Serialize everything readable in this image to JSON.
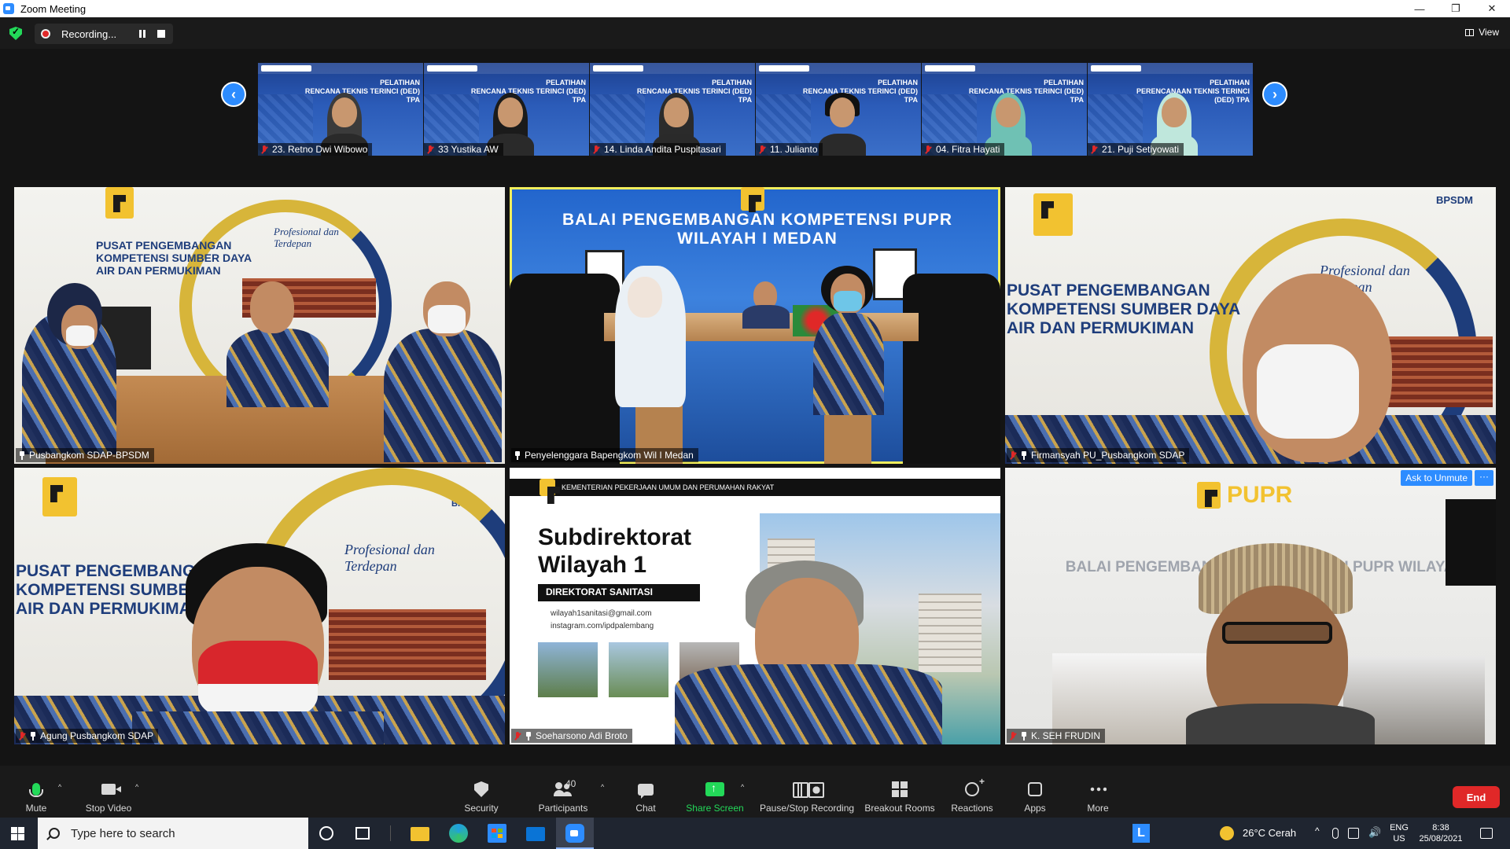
{
  "window": {
    "title": "Zoom Meeting",
    "minimize": "—",
    "restore": "❐",
    "close": "✕"
  },
  "topbar": {
    "recording_label": "Recording...",
    "view_label": "View"
  },
  "thumbnails": [
    {
      "name": "23. Retno Dwi Wibowo",
      "banner": "RENCANA TEKNIS TERINCI (DED) TPA",
      "kicker": "PELATIHAN",
      "hijab": "#3b3b3b"
    },
    {
      "name": "33 Yustika AW",
      "banner": "RENCANA TEKNIS TERINCI (DED) TPA",
      "kicker": "PELATIHAN",
      "hijab": "#1b1b1b"
    },
    {
      "name": "14. Linda Andita Puspitasari",
      "banner": "RENCANA TEKNIS TERINCI (DED) TPA",
      "kicker": "PELATIHAN",
      "hijab": "#2b2b2b"
    },
    {
      "name": "11. Julianto",
      "banner": "RENCANA TEKNIS TERINCI (DED) TPA",
      "kicker": "PELATIHAN",
      "hijab": "#111111"
    },
    {
      "name": "04. Fitra Hayati",
      "banner": "RENCANA TEKNIS TERINCI (DED) TPA",
      "kicker": "PELATIHAN",
      "hijab": "#6fc1b4"
    },
    {
      "name": "21. Puji Setiyowati",
      "banner": "PERENCANAAN TEKNIS TERINCI (DED) TPA",
      "kicker": "PELATIHAN",
      "hijab": "#bfe7dc"
    }
  ],
  "tiles": [
    {
      "name": "Pusbangkom SDAP-BPSDM",
      "banner": "PUSAT PENGEMBANGAN KOMPETENSI SUMBER DAYA AIR DAN PERMUKIMAN",
      "slogan": "Profesional dan Terdepan"
    },
    {
      "name": "Penyelenggara Bapengkom Wil I Medan",
      "banner": "BALAI PENGEMBANGAN KOMPETENSI PUPR WILAYAH I MEDAN"
    },
    {
      "name": "Firmansyah PU_Pusbangkom SDAP",
      "banner": "PUSAT PENGEMBANGAN KOMPETENSI SUMBER DAYA AIR DAN PERMUKIMAN",
      "slogan": "Profesional dan Terdepan",
      "brand": "BPSDM"
    },
    {
      "name": "Agung Pusbangkom SDAP",
      "banner": "PUSAT PENGEMBANGAN KOMPETENSI SUMBER DAYA AIR DAN PERMUKIMAN",
      "slogan": "Profesional dan Terdepan",
      "brand": "BPSDM"
    },
    {
      "name": "Soeharsono Adi Broto",
      "ministry": "KEMENTERIAN PEKERJAAN UMUM DAN PERUMAHAN RAKYAT",
      "title": "Subdirektorat Wilayah 1",
      "subtitle": "DIREKTORAT SANITASI",
      "email": "wilayah1sanitasi@gmail.com",
      "instagram": "instagram.com/ipdpalembang"
    },
    {
      "name": "K. SEH FRUDIN",
      "banner": "BALAI PENGEMBANGAN KOMPETENSI PUPR WILAYAH",
      "brand": "PUPR",
      "ask_unmute": "Ask to Unmute",
      "more": "···"
    }
  ],
  "toolbar": {
    "mute": "Mute",
    "stop_video": "Stop Video",
    "security": "Security",
    "participants": "Participants",
    "participant_count": "40",
    "chat": "Chat",
    "share_screen": "Share Screen",
    "pause_stop_recording": "Pause/Stop Recording",
    "breakout_rooms": "Breakout Rooms",
    "reactions": "Reactions",
    "apps": "Apps",
    "more": "More",
    "end": "End"
  },
  "taskbar": {
    "search_placeholder": "Type here to search",
    "weather": "26°C  Cerah",
    "lang_top": "ENG",
    "lang_bottom": "US",
    "time": "8:38",
    "date": "25/08/2021",
    "l_app": "L"
  },
  "colors": {
    "accent": "#2d8cff",
    "recording": "#e02828",
    "secure": "#23d959",
    "active_speaker": "#f2ee5c"
  }
}
